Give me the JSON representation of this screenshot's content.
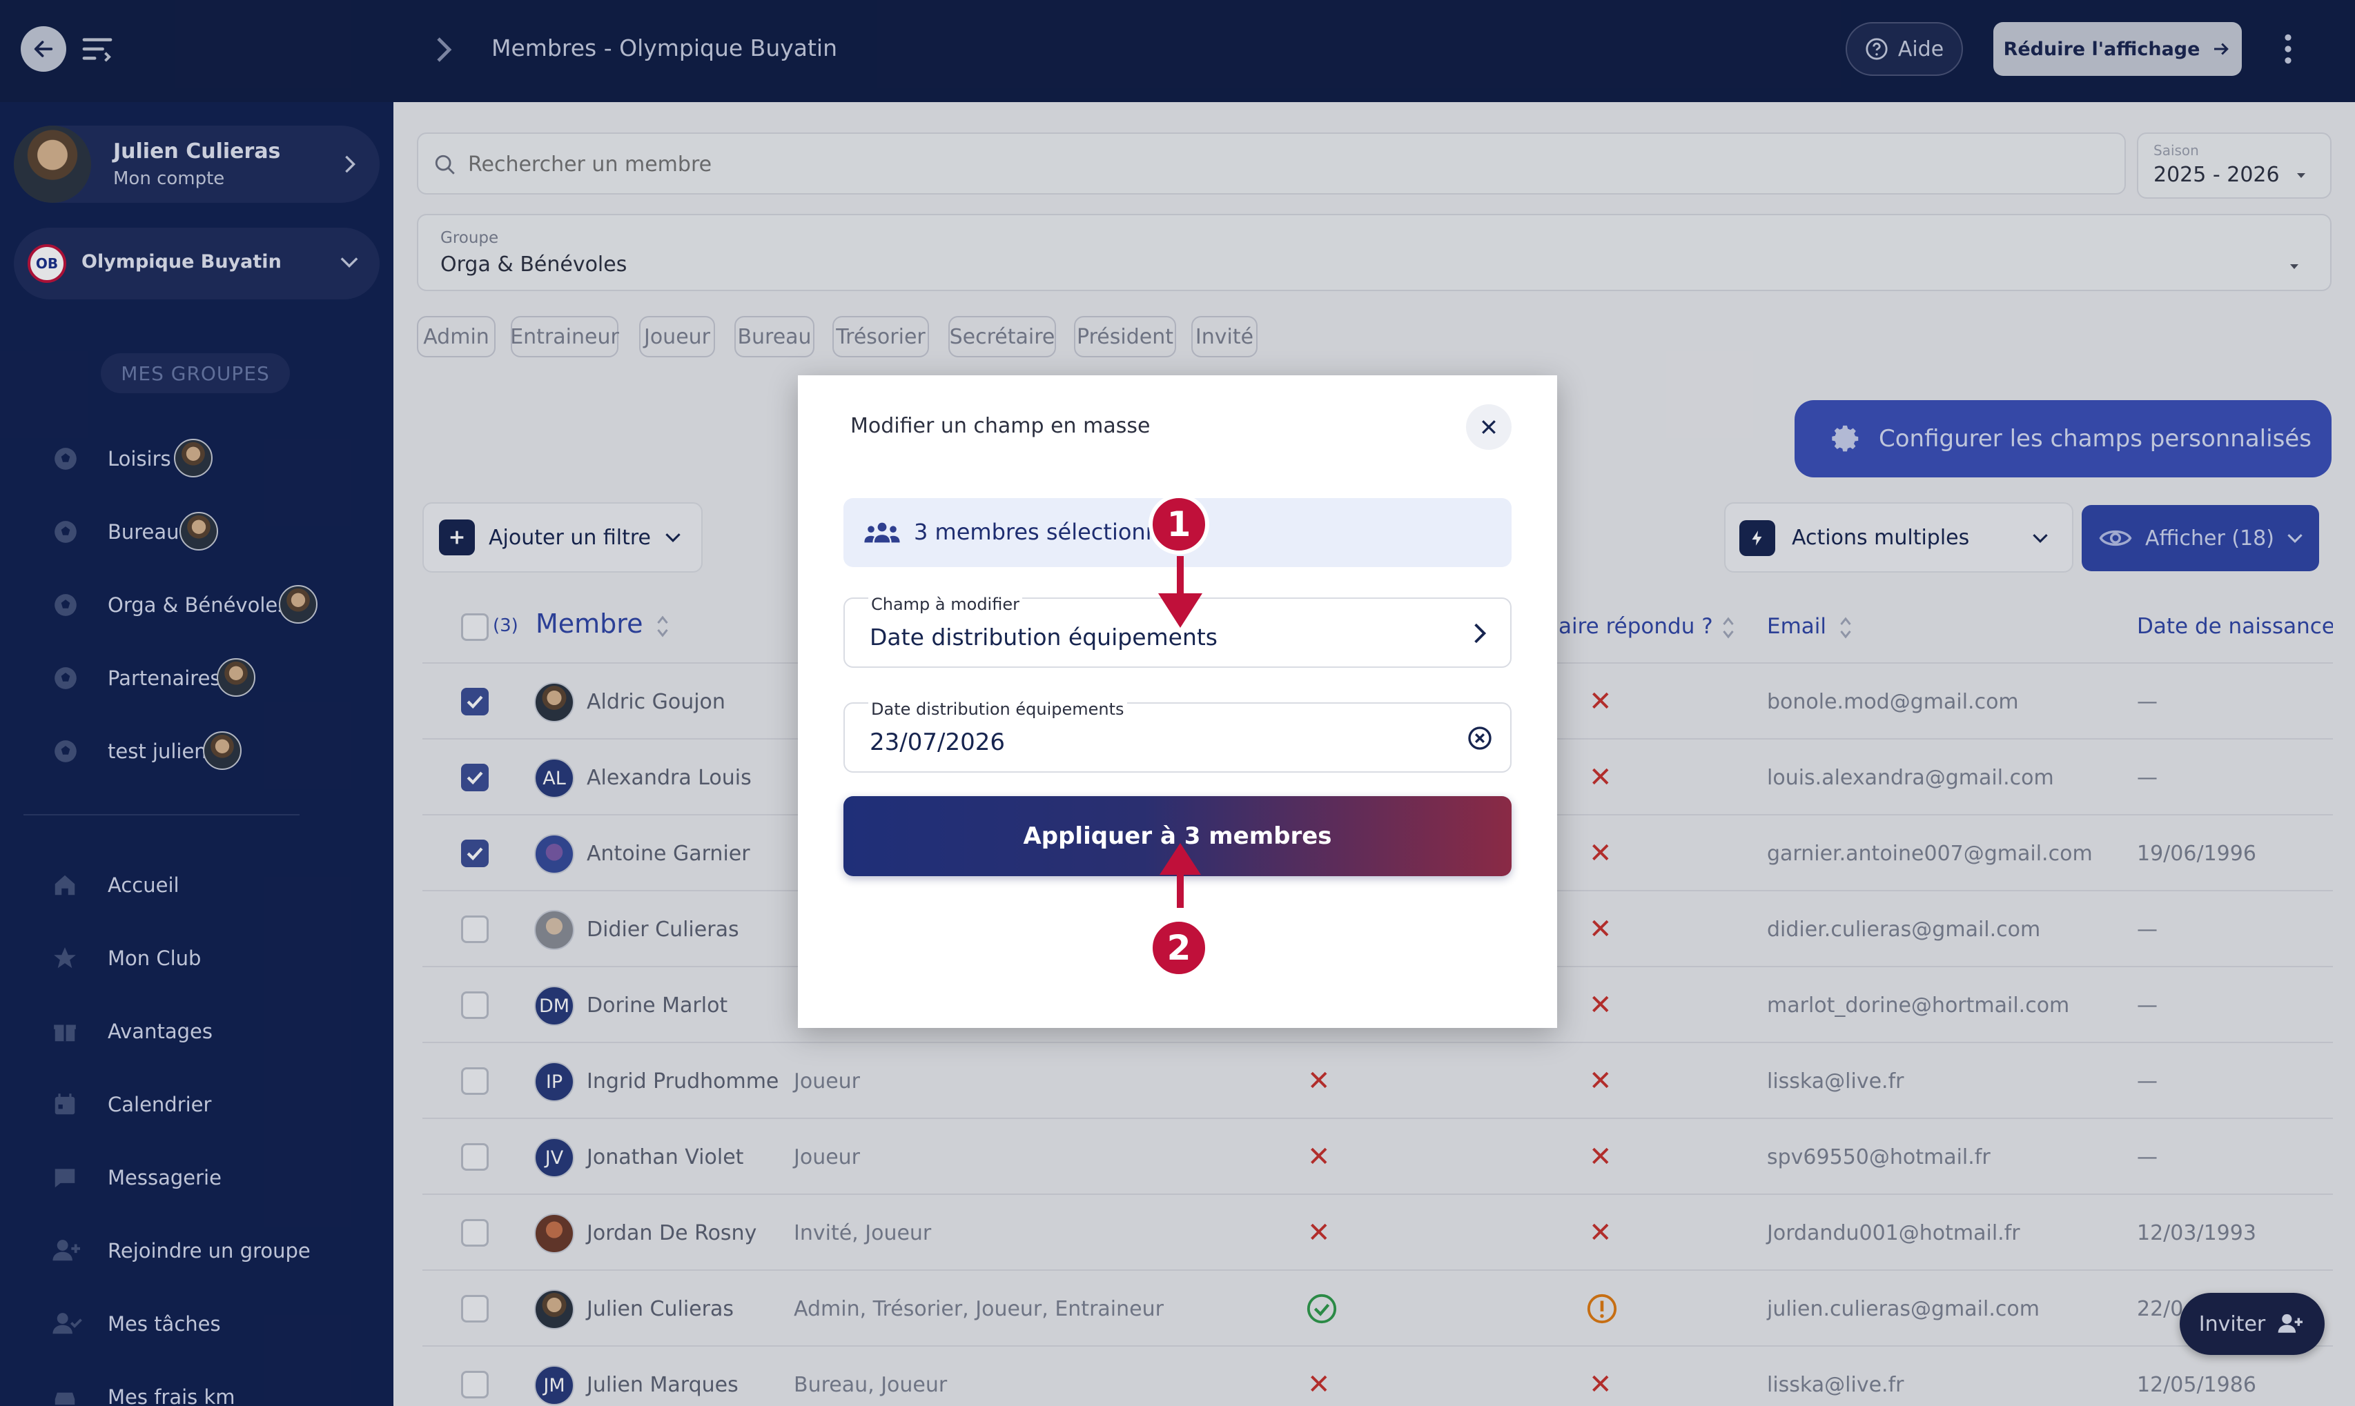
{
  "header": {
    "breadcrumb": "Membres - Olympique Buyatin",
    "help_label": "Aide",
    "reduce_label": "Réduire l'affichage"
  },
  "account": {
    "name": "Julien Culieras",
    "subtitle": "Mon compte"
  },
  "club": {
    "initials": "OB",
    "name": "Olympique Buyatin"
  },
  "sidebar": {
    "groups_title": "MES GROUPES",
    "groups": [
      {
        "label": "Loisirs"
      },
      {
        "label": "Bureau"
      },
      {
        "label": "Orga & Bénévoles"
      },
      {
        "label": "Partenaires"
      },
      {
        "label": "test julien"
      }
    ],
    "nav": [
      {
        "label": "Accueil"
      },
      {
        "label": "Mon Club"
      },
      {
        "label": "Avantages"
      },
      {
        "label": "Calendrier"
      },
      {
        "label": "Messagerie"
      },
      {
        "label": "Rejoindre un groupe"
      },
      {
        "label": "Mes tâches"
      },
      {
        "label": "Mes frais km"
      }
    ]
  },
  "search": {
    "placeholder": "Rechercher un membre"
  },
  "season": {
    "label": "Saison",
    "value": "2025 - 2026"
  },
  "group_select": {
    "label": "Groupe",
    "value": "Orga & Bénévoles"
  },
  "role_chips": [
    "Admin",
    "Entraineur",
    "Joueur",
    "Bureau",
    "Trésorier",
    "Secrétaire",
    "Président",
    "Invité"
  ],
  "config_button": "Configurer les champs personnalisés",
  "add_filter": "Ajouter un filtre",
  "actions_multiple": "Actions multiples",
  "show_button": "Afficher (18)",
  "table": {
    "selected_count": "(3)",
    "col_member": "Membre",
    "col_form": "aire répondu ?",
    "col_email": "Email",
    "col_birth": "Date de naissance",
    "rows": [
      {
        "name": "Aldric Goujon",
        "initials": "",
        "role": "",
        "email": "bonole.mod@gmail.com",
        "birth": "—",
        "checked": true
      },
      {
        "name": "Alexandra Louis",
        "initials": "AL",
        "role": "",
        "email": "louis.alexandra@gmail.com",
        "birth": "—",
        "checked": true
      },
      {
        "name": "Antoine Garnier",
        "initials": "",
        "role": "",
        "email": "garnier.antoine007@gmail.com",
        "birth": "19/06/1996",
        "checked": true
      },
      {
        "name": "Didier Culieras",
        "initials": "",
        "role": "",
        "email": "didier.culieras@gmail.com",
        "birth": "—",
        "checked": false
      },
      {
        "name": "Dorine Marlot",
        "initials": "DM",
        "role": "",
        "email": "marlot_dorine@hortmail.com",
        "birth": "—",
        "checked": false
      },
      {
        "name": "Ingrid Prudhomme",
        "initials": "IP",
        "role": "Joueur",
        "email": "lisska@live.fr",
        "birth": "—",
        "checked": false
      },
      {
        "name": "Jonathan Violet",
        "initials": "JV",
        "role": "Joueur",
        "email": "spv69550@hotmail.fr",
        "birth": "—",
        "checked": false
      },
      {
        "name": "Jordan De Rosny",
        "initials": "",
        "role": "Invité, Joueur",
        "email": "Jordandu001@hotmail.fr",
        "birth": "12/03/1993",
        "checked": false
      },
      {
        "name": "Julien Culieras",
        "initials": "",
        "role": "Admin, Trésorier, Joueur, Entraineur",
        "email": "julien.culieras@gmail.com",
        "birth": "22/0",
        "checked": false
      },
      {
        "name": "Julien Marques",
        "initials": "JM",
        "role": "Bureau, Joueur",
        "email": "lisska@live.fr",
        "birth": "12/05/1986",
        "checked": false
      }
    ]
  },
  "modal": {
    "title": "Modifier un champ en masse",
    "selected_text": "3 membres sélectionnés",
    "field_label": "Champ à modifier",
    "field_value": "Date distribution équipements",
    "date_label": "Date distribution équipements",
    "date_value": "23/07/2026",
    "apply_label": "Appliquer à 3 membres"
  },
  "annotations": {
    "step1": "1",
    "step2": "2"
  },
  "invite_button": "Inviter"
}
